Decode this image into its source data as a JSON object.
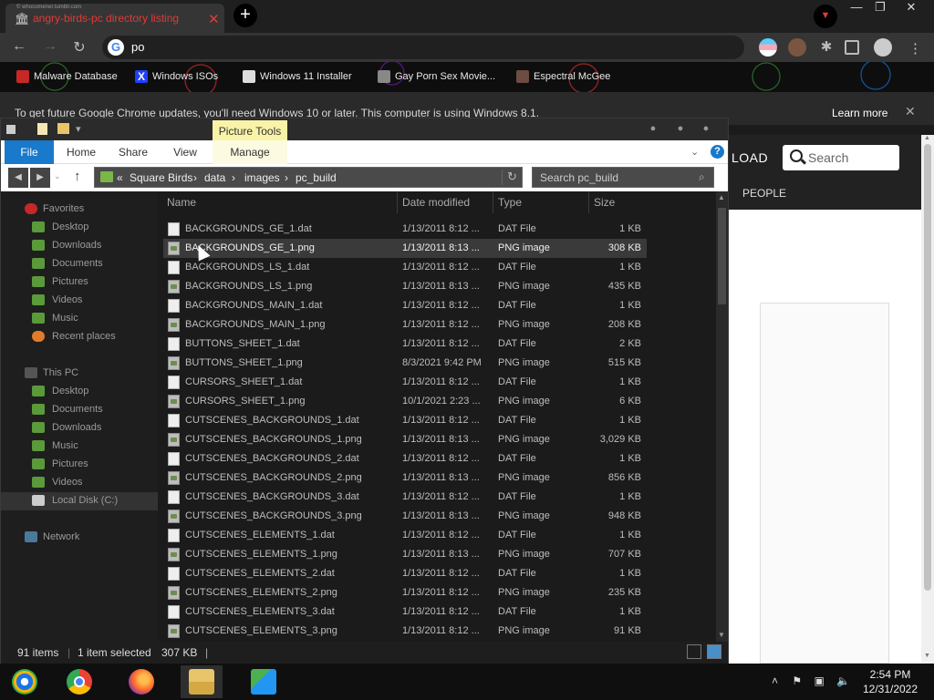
{
  "browser": {
    "tab_site": "© whocomener.tumblr.com",
    "tab_title": "angry-birds-pc directory listing",
    "tab_close": "✕",
    "new_tab": "+",
    "omnibox_value": "po",
    "bookmarks": [
      {
        "label": "Malware Database",
        "icon": "red-dot-icon"
      },
      {
        "label": "Windows ISOs",
        "icon": "x-logo-icon"
      },
      {
        "label": "Windows 11 Installer",
        "icon": "windows-installer-icon"
      },
      {
        "label": "Gay Porn Sex Movie...",
        "icon": "site-icon"
      },
      {
        "label": "Espectral McGee",
        "icon": "site-icon"
      }
    ],
    "infobar_message": "To get future Google Chrome updates, you'll need Windows 10 or later. This computer is using Windows 8.1.",
    "learn_more": "Learn more"
  },
  "webpage": {
    "upload_partial": "LOAD",
    "search_placeholder": "Search",
    "people": "PEOPLE"
  },
  "explorer": {
    "picture_tools": "Picture Tools",
    "ribbon_tabs": {
      "file": "File",
      "home": "Home",
      "share": "Share",
      "view": "View",
      "manage": "Manage"
    },
    "breadcrumb": {
      "overflow": "«",
      "items": [
        "Square Birds",
        "data",
        "images",
        "pc_build"
      ],
      "sep": "›"
    },
    "search_placeholder": "Search pc_build",
    "columns": {
      "name": "Name",
      "date": "Date modified",
      "type": "Type",
      "size": "Size"
    },
    "nav": {
      "favorites": "Favorites",
      "desktop": "Desktop",
      "downloads": "Downloads",
      "documents": "Documents",
      "pictures": "Pictures",
      "videos": "Videos",
      "music": "Music",
      "recent": "Recent places",
      "thispc": "This PC",
      "pc_desktop": "Desktop",
      "pc_documents": "Documents",
      "pc_downloads": "Downloads",
      "pc_music": "Music",
      "pc_pictures": "Pictures",
      "pc_videos": "Videos",
      "local_disk": "Local Disk (C:)",
      "network": "Network"
    },
    "files": [
      {
        "name": "BACKGROUNDS_GE_1.dat",
        "date": "1/13/2011 8:12 ...",
        "type": "DAT File",
        "size": "1 KB",
        "kind": "dat"
      },
      {
        "name": "BACKGROUNDS_GE_1.png",
        "date": "1/13/2011 8:13 ...",
        "type": "PNG image",
        "size": "308 KB",
        "kind": "png"
      },
      {
        "name": "BACKGROUNDS_LS_1.dat",
        "date": "1/13/2011 8:12 ...",
        "type": "DAT File",
        "size": "1 KB",
        "kind": "dat"
      },
      {
        "name": "BACKGROUNDS_LS_1.png",
        "date": "1/13/2011 8:13 ...",
        "type": "PNG image",
        "size": "435 KB",
        "kind": "png"
      },
      {
        "name": "BACKGROUNDS_MAIN_1.dat",
        "date": "1/13/2011 8:12 ...",
        "type": "DAT File",
        "size": "1 KB",
        "kind": "dat"
      },
      {
        "name": "BACKGROUNDS_MAIN_1.png",
        "date": "1/13/2011 8:12 ...",
        "type": "PNG image",
        "size": "208 KB",
        "kind": "png"
      },
      {
        "name": "BUTTONS_SHEET_1.dat",
        "date": "1/13/2011 8:12 ...",
        "type": "DAT File",
        "size": "2 KB",
        "kind": "dat"
      },
      {
        "name": "BUTTONS_SHEET_1.png",
        "date": "8/3/2021 9:42 PM",
        "type": "PNG image",
        "size": "515 KB",
        "kind": "png"
      },
      {
        "name": "CURSORS_SHEET_1.dat",
        "date": "1/13/2011 8:12 ...",
        "type": "DAT File",
        "size": "1 KB",
        "kind": "dat"
      },
      {
        "name": "CURSORS_SHEET_1.png",
        "date": "10/1/2021 2:23 ...",
        "type": "PNG image",
        "size": "6 KB",
        "kind": "png"
      },
      {
        "name": "CUTSCENES_BACKGROUNDS_1.dat",
        "date": "1/13/2011 8:12 ...",
        "type": "DAT File",
        "size": "1 KB",
        "kind": "dat"
      },
      {
        "name": "CUTSCENES_BACKGROUNDS_1.png",
        "date": "1/13/2011 8:13 ...",
        "type": "PNG image",
        "size": "3,029 KB",
        "kind": "png"
      },
      {
        "name": "CUTSCENES_BACKGROUNDS_2.dat",
        "date": "1/13/2011 8:12 ...",
        "type": "DAT File",
        "size": "1 KB",
        "kind": "dat"
      },
      {
        "name": "CUTSCENES_BACKGROUNDS_2.png",
        "date": "1/13/2011 8:13 ...",
        "type": "PNG image",
        "size": "856 KB",
        "kind": "png"
      },
      {
        "name": "CUTSCENES_BACKGROUNDS_3.dat",
        "date": "1/13/2011 8:12 ...",
        "type": "DAT File",
        "size": "1 KB",
        "kind": "dat"
      },
      {
        "name": "CUTSCENES_BACKGROUNDS_3.png",
        "date": "1/13/2011 8:13 ...",
        "type": "PNG image",
        "size": "948 KB",
        "kind": "png"
      },
      {
        "name": "CUTSCENES_ELEMENTS_1.dat",
        "date": "1/13/2011 8:12 ...",
        "type": "DAT File",
        "size": "1 KB",
        "kind": "dat"
      },
      {
        "name": "CUTSCENES_ELEMENTS_1.png",
        "date": "1/13/2011 8:13 ...",
        "type": "PNG image",
        "size": "707 KB",
        "kind": "png"
      },
      {
        "name": "CUTSCENES_ELEMENTS_2.dat",
        "date": "1/13/2011 8:12 ...",
        "type": "DAT File",
        "size": "1 KB",
        "kind": "dat"
      },
      {
        "name": "CUTSCENES_ELEMENTS_2.png",
        "date": "1/13/2011 8:12 ...",
        "type": "PNG image",
        "size": "235 KB",
        "kind": "png"
      },
      {
        "name": "CUTSCENES_ELEMENTS_3.dat",
        "date": "1/13/2011 8:12 ...",
        "type": "DAT File",
        "size": "1 KB",
        "kind": "dat"
      },
      {
        "name": "CUTSCENES_ELEMENTS_3.png",
        "date": "1/13/2011 8:12 ...",
        "type": "PNG image",
        "size": "91 KB",
        "kind": "png"
      }
    ],
    "selected_index": 1,
    "status": {
      "items": "91 items",
      "selected": "1 item selected",
      "size": "307 KB"
    }
  },
  "taskbar": {
    "apps": [
      {
        "name": "tb-explorer-classic",
        "icon": "windows-explorer-icon"
      },
      {
        "name": "tb-chrome",
        "icon": "chrome-icon"
      },
      {
        "name": "tb-firefox",
        "icon": "firefox-icon"
      },
      {
        "name": "tb-file-explorer",
        "icon": "folder-icon",
        "active": true
      },
      {
        "name": "tb-network-app",
        "icon": "network-people-icon"
      }
    ],
    "time": "2:54 PM",
    "date": "12/31/2022"
  },
  "colors": {
    "accent_file_tab": "#1979ca",
    "picture_tools": "#f9f3a8",
    "tab_title": "#e53935"
  }
}
